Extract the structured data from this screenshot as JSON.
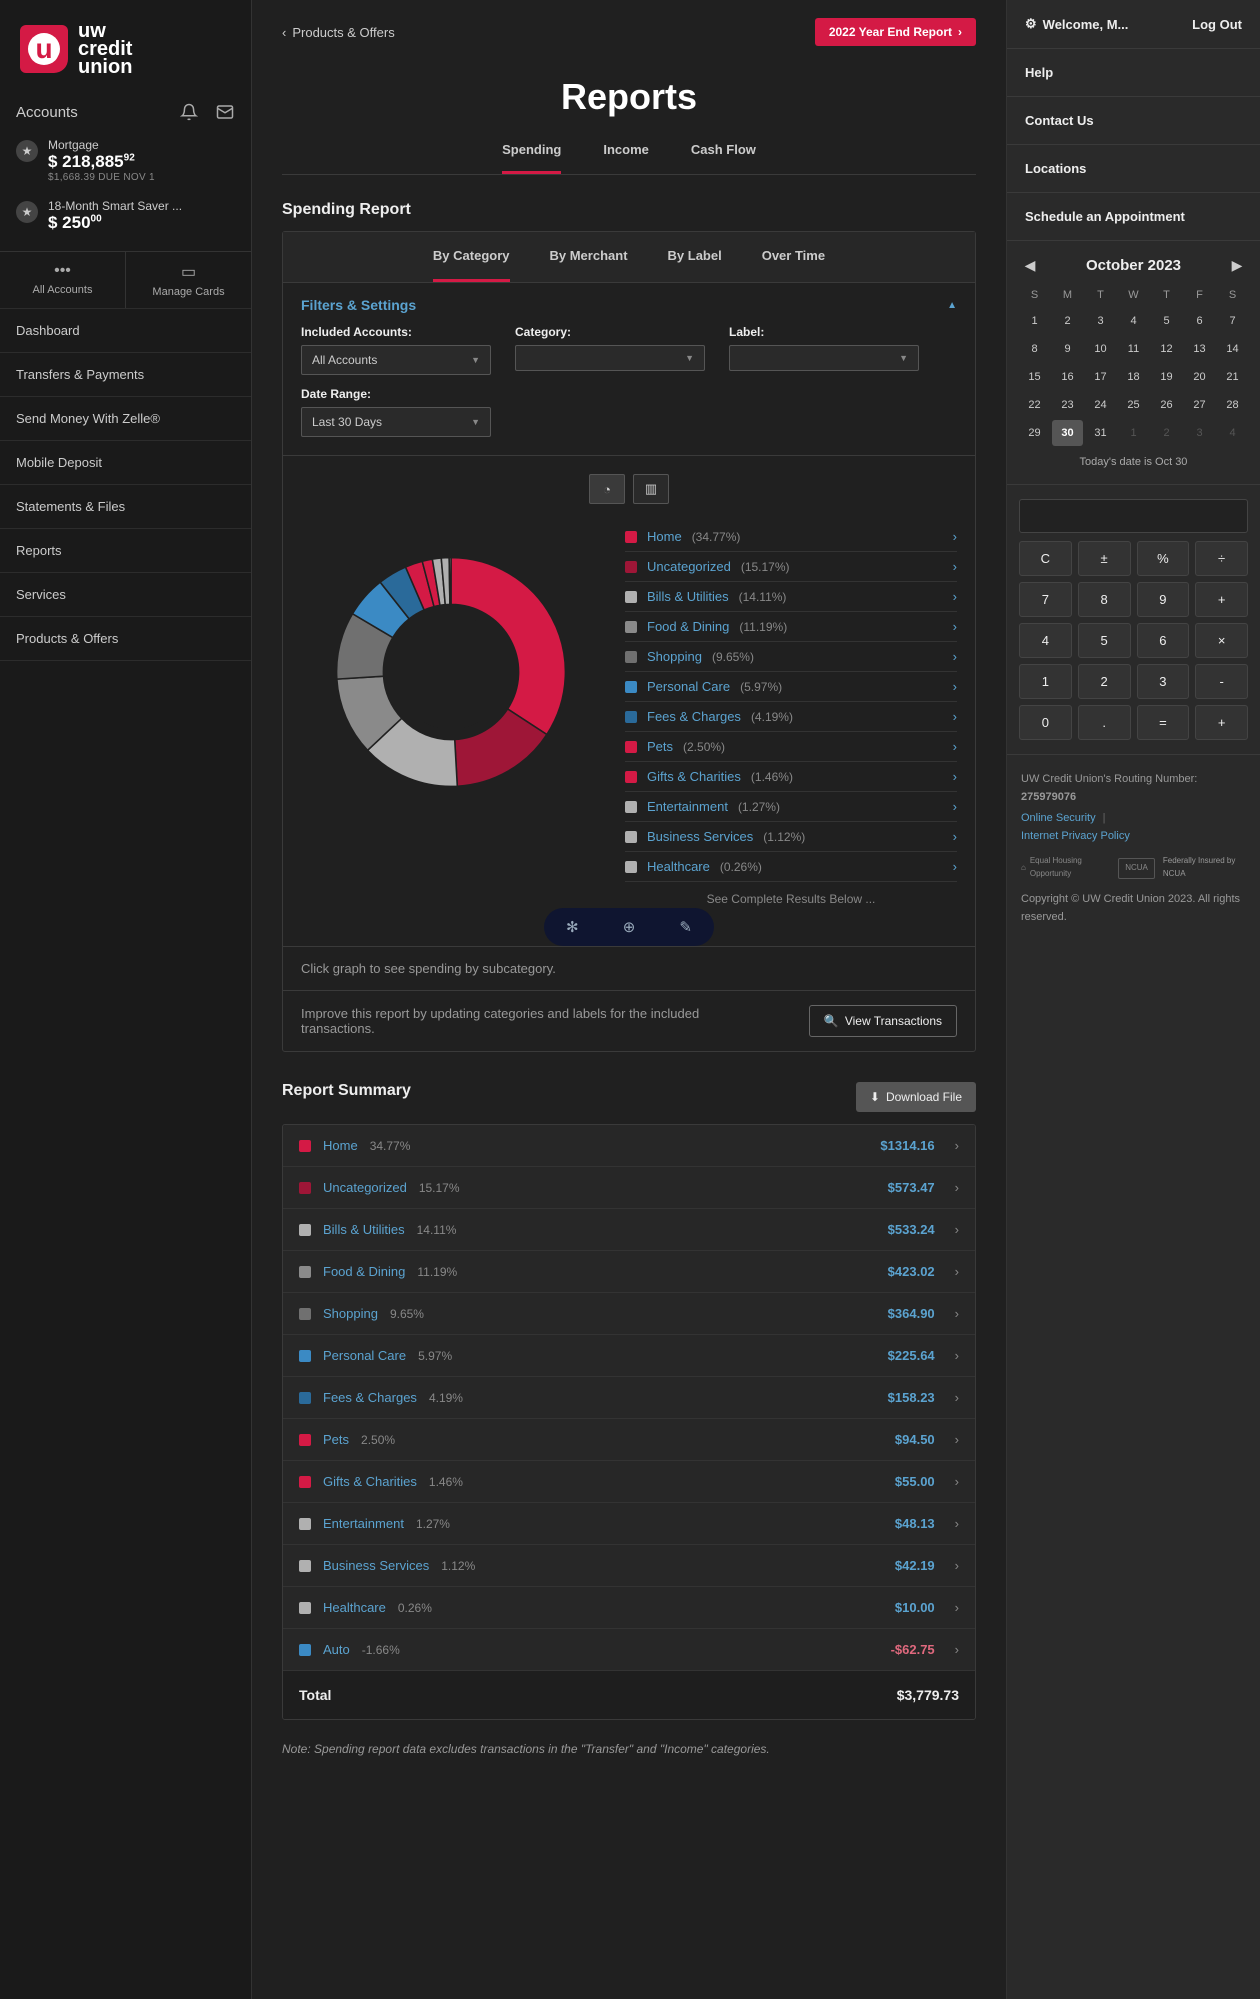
{
  "brand": {
    "name_line1": "uw",
    "name_line2": "credit",
    "name_line3": "union"
  },
  "left_sidebar": {
    "accounts_label": "Accounts",
    "accounts": [
      {
        "name": "Mortgage",
        "balance_whole": "218,885",
        "balance_cents": "92",
        "due": "$1,668.39 DUE NOV 1"
      },
      {
        "name": "18-Month Smart Saver ...",
        "balance_whole": "250",
        "balance_cents": "00",
        "due": ""
      }
    ],
    "actions": [
      {
        "icon": "•••",
        "label": "All Accounts"
      },
      {
        "icon": "▭",
        "label": "Manage Cards"
      }
    ],
    "nav": [
      "Dashboard",
      "Transfers & Payments",
      "Send Money With Zelle®",
      "Mobile Deposit",
      "Statements & Files",
      "Reports",
      "Services",
      "Products & Offers"
    ]
  },
  "main": {
    "breadcrumb": "Products & Offers",
    "year_end_btn": "2022 Year End Report",
    "title": "Reports",
    "tabs": [
      "Spending",
      "Income",
      "Cash Flow"
    ],
    "section_title": "Spending Report",
    "subtabs": [
      "By Category",
      "By Merchant",
      "By Label",
      "Over Time"
    ],
    "filters": {
      "title": "Filters & Settings",
      "included_accounts_label": "Included Accounts:",
      "included_accounts_value": "All Accounts",
      "category_label": "Category:",
      "category_value": "",
      "label_label": "Label:",
      "label_value": "",
      "date_range_label": "Date Range:",
      "date_range_value": "Last 30 Days"
    },
    "legend_more": "See Complete Results Below ...",
    "chart_hint": "Click graph to see spending by subcategory.",
    "improve_text": "Improve this report by updating categories and labels for the included transactions.",
    "view_tx_btn": "View Transactions",
    "summary_title": "Report Summary",
    "download_btn": "Download File",
    "total_label": "Total",
    "total_amount": "$3,779.73",
    "footnote": "Note: Spending report data excludes transactions in the \"Transfer\" and \"Income\" categories."
  },
  "right_sidebar": {
    "welcome": "Welcome, M...",
    "logout": "Log Out",
    "nav": [
      "Help",
      "Contact Us",
      "Locations",
      "Schedule an Appointment"
    ],
    "calendar": {
      "title": "October 2023",
      "dow": [
        "S",
        "M",
        "T",
        "W",
        "T",
        "F",
        "S"
      ],
      "weeks": [
        [
          {
            "d": "1"
          },
          {
            "d": "2"
          },
          {
            "d": "3"
          },
          {
            "d": "4"
          },
          {
            "d": "5"
          },
          {
            "d": "6"
          },
          {
            "d": "7"
          }
        ],
        [
          {
            "d": "8"
          },
          {
            "d": "9"
          },
          {
            "d": "10"
          },
          {
            "d": "11"
          },
          {
            "d": "12"
          },
          {
            "d": "13"
          },
          {
            "d": "14"
          }
        ],
        [
          {
            "d": "15"
          },
          {
            "d": "16"
          },
          {
            "d": "17"
          },
          {
            "d": "18"
          },
          {
            "d": "19"
          },
          {
            "d": "20"
          },
          {
            "d": "21"
          }
        ],
        [
          {
            "d": "22"
          },
          {
            "d": "23"
          },
          {
            "d": "24"
          },
          {
            "d": "25"
          },
          {
            "d": "26"
          },
          {
            "d": "27"
          },
          {
            "d": "28"
          }
        ],
        [
          {
            "d": "29"
          },
          {
            "d": "30",
            "today": true
          },
          {
            "d": "31"
          },
          {
            "d": "1",
            "muted": true
          },
          {
            "d": "2",
            "muted": true
          },
          {
            "d": "3",
            "muted": true
          },
          {
            "d": "4",
            "muted": true
          }
        ]
      ],
      "today_text": "Today's date is Oct 30"
    },
    "calc_buttons": [
      "C",
      "±",
      "%",
      "÷",
      "7",
      "8",
      "9",
      "+",
      "4",
      "5",
      "6",
      "×",
      "1",
      "2",
      "3",
      "-",
      "0",
      ".",
      "=",
      "+"
    ],
    "footer": {
      "routing_label": "UW Credit Union's Routing Number:",
      "routing_number": "275979076",
      "link_security": "Online Security",
      "link_privacy": "Internet Privacy Policy",
      "eho": "Equal Housing Opportunity",
      "ncua": "NCUA",
      "ncua_sub": "Federally Insured by NCUA",
      "copyright": "Copyright © UW Credit Union 2023. All rights reserved."
    }
  },
  "chart_data": {
    "type": "pie",
    "title": "Spending by Category — Last 30 Days",
    "total": 3779.73,
    "series": [
      {
        "name": "Home",
        "pct": 34.77,
        "amount": 1314.16,
        "color": "#d41a45"
      },
      {
        "name": "Uncategorized",
        "pct": 15.17,
        "amount": 573.47,
        "color": "#9e1637"
      },
      {
        "name": "Bills & Utilities",
        "pct": 14.11,
        "amount": 533.24,
        "color": "#b0b0b0"
      },
      {
        "name": "Food & Dining",
        "pct": 11.19,
        "amount": 423.02,
        "color": "#8a8a8a"
      },
      {
        "name": "Shopping",
        "pct": 9.65,
        "amount": 364.9,
        "color": "#707070"
      },
      {
        "name": "Personal Care",
        "pct": 5.97,
        "amount": 225.64,
        "color": "#3b8ac4"
      },
      {
        "name": "Fees & Charges",
        "pct": 4.19,
        "amount": 158.23,
        "color": "#2a6a9a"
      },
      {
        "name": "Pets",
        "pct": 2.5,
        "amount": 94.5,
        "color": "#d41a45"
      },
      {
        "name": "Gifts & Charities",
        "pct": 1.46,
        "amount": 55.0,
        "color": "#d41a45"
      },
      {
        "name": "Entertainment",
        "pct": 1.27,
        "amount": 48.13,
        "color": "#b0b0b0"
      },
      {
        "name": "Business Services",
        "pct": 1.12,
        "amount": 42.19,
        "color": "#b0b0b0"
      },
      {
        "name": "Healthcare",
        "pct": 0.26,
        "amount": 10.0,
        "color": "#b0b0b0"
      },
      {
        "name": "Auto",
        "pct": -1.66,
        "amount": -62.75,
        "color": "#3b8ac4"
      }
    ]
  }
}
